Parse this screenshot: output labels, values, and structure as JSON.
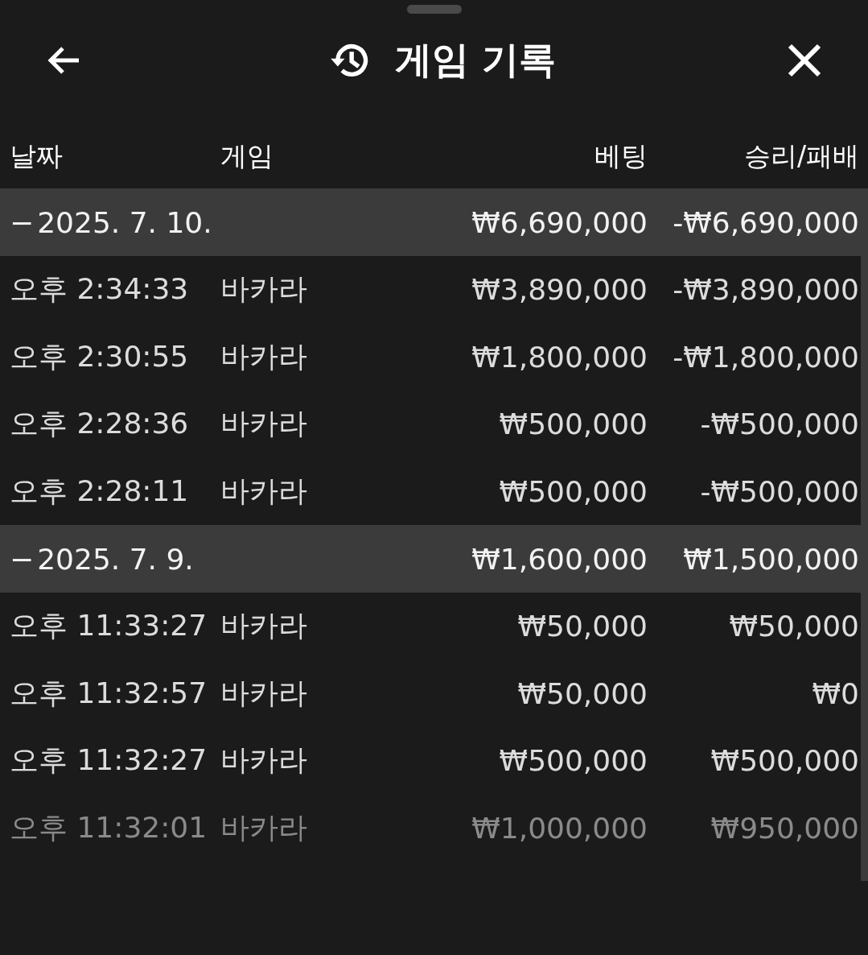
{
  "header": {
    "title": "게임 기록"
  },
  "columns": [
    "날짜",
    "게임",
    "베팅",
    "승리/패배"
  ],
  "groups": [
    {
      "toggle": "−",
      "date": "2025. 7. 10.",
      "expanded": true,
      "bet": "₩6,690,000",
      "result": "-₩6,690,000",
      "rows": [
        {
          "time": "오후 2:34:33",
          "game": "바카라",
          "bet": "₩3,890,000",
          "result": "-₩3,890,000",
          "faded": false
        },
        {
          "time": "오후 2:30:55",
          "game": "바카라",
          "bet": "₩1,800,000",
          "result": "-₩1,800,000",
          "faded": false
        },
        {
          "time": "오후 2:28:36",
          "game": "바카라",
          "bet": "₩500,000",
          "result": "-₩500,000",
          "faded": false
        },
        {
          "time": "오후 2:28:11",
          "game": "바카라",
          "bet": "₩500,000",
          "result": "-₩500,000",
          "faded": false
        }
      ]
    },
    {
      "toggle": "−",
      "date": "2025. 7. 9.",
      "expanded": true,
      "bet": "₩1,600,000",
      "result": "₩1,500,000",
      "rows": [
        {
          "time": "오후 11:33:27",
          "game": "바카라",
          "bet": "₩50,000",
          "result": "₩50,000",
          "faded": false
        },
        {
          "time": "오후 11:32:57",
          "game": "바카라",
          "bet": "₩50,000",
          "result": "₩0",
          "faded": false
        },
        {
          "time": "오후 11:32:27",
          "game": "바카라",
          "bet": "₩500,000",
          "result": "₩500,000",
          "faded": false
        },
        {
          "time": "오후 11:32:01",
          "game": "바카라",
          "bet": "₩1,000,000",
          "result": "₩950,000",
          "faded": true
        }
      ]
    }
  ]
}
